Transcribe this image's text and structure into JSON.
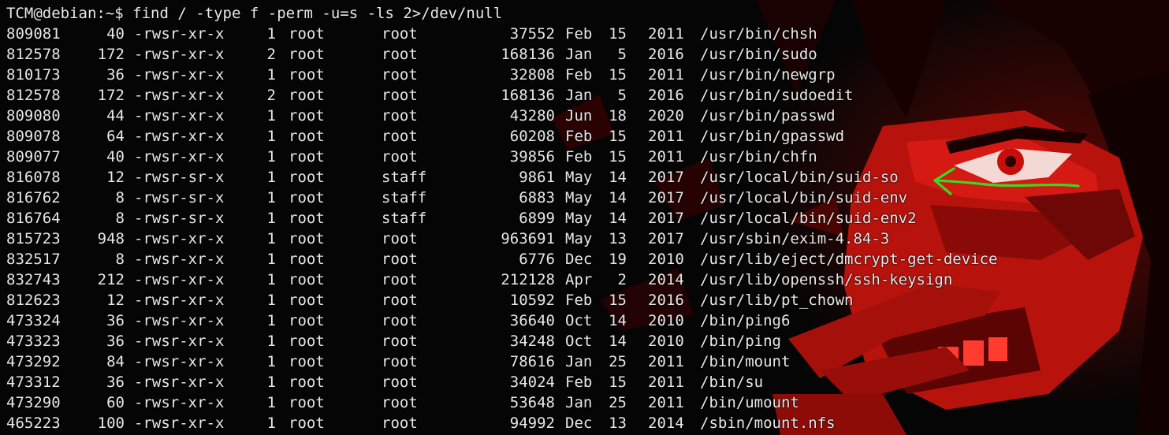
{
  "terminal": {
    "prompt": "TCM@debian:~$",
    "command": "find / -type f -perm -u=s -ls 2>/dev/null",
    "rows": [
      {
        "inode": "809081",
        "blocks": "40",
        "perm": "-rwsr-xr-x",
        "links": "1",
        "owner": "root",
        "group": "root",
        "size": "37552",
        "month": "Feb",
        "day": "15",
        "year": "2011",
        "path": "/usr/bin/chsh"
      },
      {
        "inode": "812578",
        "blocks": "172",
        "perm": "-rwsr-xr-x",
        "links": "2",
        "owner": "root",
        "group": "root",
        "size": "168136",
        "month": "Jan",
        "day": "5",
        "year": "2016",
        "path": "/usr/bin/sudo"
      },
      {
        "inode": "810173",
        "blocks": "36",
        "perm": "-rwsr-xr-x",
        "links": "1",
        "owner": "root",
        "group": "root",
        "size": "32808",
        "month": "Feb",
        "day": "15",
        "year": "2011",
        "path": "/usr/bin/newgrp"
      },
      {
        "inode": "812578",
        "blocks": "172",
        "perm": "-rwsr-xr-x",
        "links": "2",
        "owner": "root",
        "group": "root",
        "size": "168136",
        "month": "Jan",
        "day": "5",
        "year": "2016",
        "path": "/usr/bin/sudoedit"
      },
      {
        "inode": "809080",
        "blocks": "44",
        "perm": "-rwsr-xr-x",
        "links": "1",
        "owner": "root",
        "group": "root",
        "size": "43280",
        "month": "Jun",
        "day": "18",
        "year": "2020",
        "path": "/usr/bin/passwd"
      },
      {
        "inode": "809078",
        "blocks": "64",
        "perm": "-rwsr-xr-x",
        "links": "1",
        "owner": "root",
        "group": "root",
        "size": "60208",
        "month": "Feb",
        "day": "15",
        "year": "2011",
        "path": "/usr/bin/gpasswd"
      },
      {
        "inode": "809077",
        "blocks": "40",
        "perm": "-rwsr-xr-x",
        "links": "1",
        "owner": "root",
        "group": "root",
        "size": "39856",
        "month": "Feb",
        "day": "15",
        "year": "2011",
        "path": "/usr/bin/chfn"
      },
      {
        "inode": "816078",
        "blocks": "12",
        "perm": "-rwsr-sr-x",
        "links": "1",
        "owner": "root",
        "group": "staff",
        "size": "9861",
        "month": "May",
        "day": "14",
        "year": "2017",
        "path": "/usr/local/bin/suid-so"
      },
      {
        "inode": "816762",
        "blocks": "8",
        "perm": "-rwsr-sr-x",
        "links": "1",
        "owner": "root",
        "group": "staff",
        "size": "6883",
        "month": "May",
        "day": "14",
        "year": "2017",
        "path": "/usr/local/bin/suid-env"
      },
      {
        "inode": "816764",
        "blocks": "8",
        "perm": "-rwsr-sr-x",
        "links": "1",
        "owner": "root",
        "group": "staff",
        "size": "6899",
        "month": "May",
        "day": "14",
        "year": "2017",
        "path": "/usr/local/bin/suid-env2"
      },
      {
        "inode": "815723",
        "blocks": "948",
        "perm": "-rwsr-xr-x",
        "links": "1",
        "owner": "root",
        "group": "root",
        "size": "963691",
        "month": "May",
        "day": "13",
        "year": "2017",
        "path": "/usr/sbin/exim-4.84-3"
      },
      {
        "inode": "832517",
        "blocks": "8",
        "perm": "-rwsr-xr-x",
        "links": "1",
        "owner": "root",
        "group": "root",
        "size": "6776",
        "month": "Dec",
        "day": "19",
        "year": "2010",
        "path": "/usr/lib/eject/dmcrypt-get-device"
      },
      {
        "inode": "832743",
        "blocks": "212",
        "perm": "-rwsr-xr-x",
        "links": "1",
        "owner": "root",
        "group": "root",
        "size": "212128",
        "month": "Apr",
        "day": "2",
        "year": "2014",
        "path": "/usr/lib/openssh/ssh-keysign"
      },
      {
        "inode": "812623",
        "blocks": "12",
        "perm": "-rwsr-xr-x",
        "links": "1",
        "owner": "root",
        "group": "root",
        "size": "10592",
        "month": "Feb",
        "day": "15",
        "year": "2016",
        "path": "/usr/lib/pt_chown"
      },
      {
        "inode": "473324",
        "blocks": "36",
        "perm": "-rwsr-xr-x",
        "links": "1",
        "owner": "root",
        "group": "root",
        "size": "36640",
        "month": "Oct",
        "day": "14",
        "year": "2010",
        "path": "/bin/ping6"
      },
      {
        "inode": "473323",
        "blocks": "36",
        "perm": "-rwsr-xr-x",
        "links": "1",
        "owner": "root",
        "group": "root",
        "size": "34248",
        "month": "Oct",
        "day": "14",
        "year": "2010",
        "path": "/bin/ping"
      },
      {
        "inode": "473292",
        "blocks": "84",
        "perm": "-rwsr-xr-x",
        "links": "1",
        "owner": "root",
        "group": "root",
        "size": "78616",
        "month": "Jan",
        "day": "25",
        "year": "2011",
        "path": "/bin/mount"
      },
      {
        "inode": "473312",
        "blocks": "36",
        "perm": "-rwsr-xr-x",
        "links": "1",
        "owner": "root",
        "group": "root",
        "size": "34024",
        "month": "Feb",
        "day": "15",
        "year": "2011",
        "path": "/bin/su"
      },
      {
        "inode": "473290",
        "blocks": "60",
        "perm": "-rwsr-xr-x",
        "links": "1",
        "owner": "root",
        "group": "root",
        "size": "53648",
        "month": "Jan",
        "day": "25",
        "year": "2011",
        "path": "/bin/umount"
      },
      {
        "inode": "465223",
        "blocks": "100",
        "perm": "-rwsr-xr-x",
        "links": "1",
        "owner": "root",
        "group": "root",
        "size": "94992",
        "month": "Dec",
        "day": "13",
        "year": "2014",
        "path": "/sbin/mount.nfs"
      }
    ]
  },
  "colors": {
    "text": "#e8e8e8",
    "background": "#050505",
    "wallpaper_red": "#c8140e",
    "annotation_green": "#33dd22"
  },
  "wallpaper": {
    "icon": "anime-red-character-wallpaper"
  },
  "annotation": {
    "icon": "green-arrow-icon",
    "points_to": "/usr/local/bin/suid-so"
  }
}
